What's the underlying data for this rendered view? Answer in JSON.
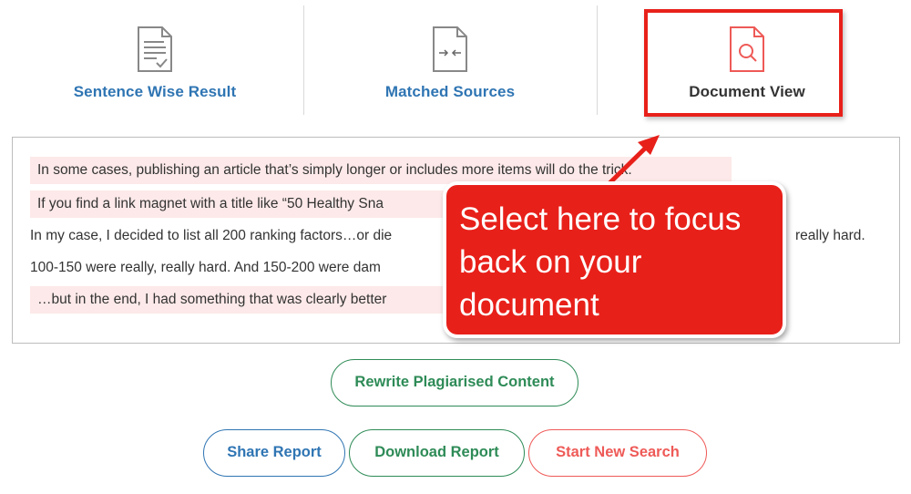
{
  "tabs": [
    {
      "label": "Sentence Wise Result",
      "icon": "document-check-icon"
    },
    {
      "label": "Matched Sources",
      "icon": "document-compare-icon"
    },
    {
      "label": "Document View",
      "icon": "document-search-icon"
    }
  ],
  "document": {
    "lines": [
      "In some cases, publishing an article that’s simply longer or includes more items will do the trick.",
      "If you find a link magnet with a title like “50 Healthy Sna",
      "In my case, I decided to list all 200 ranking factors…or die",
      "really hard.",
      "100-150 were really, really hard. And 150-200 were dam",
      "…but in the end, I had something that was clearly better"
    ]
  },
  "callout": {
    "text": "Select here to focus back on your document"
  },
  "buttons": {
    "rewrite": "Rewrite Plagiarised Content",
    "share": "Share Report",
    "download": "Download Report",
    "new_search": "Start New Search"
  },
  "colors": {
    "accent_red": "#e8201a",
    "tab_blue": "#2f75b3",
    "green": "#2e8b57",
    "highlight_bg": "#fde9e9"
  }
}
